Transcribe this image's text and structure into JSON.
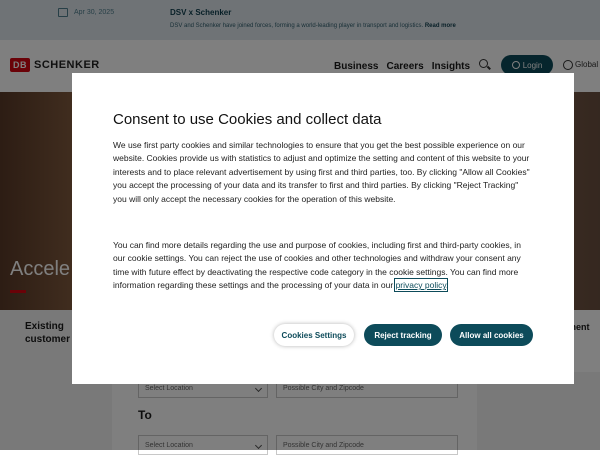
{
  "announcement": {
    "date": "Apr 30, 2025",
    "title": "DSV x Schenker",
    "text": "DSV and Schenker have joined forces, forming a world-leading player in transport and logistics.",
    "read_more": "Read more"
  },
  "header": {
    "logo_mark": "DB",
    "logo_name": "SCHENKER",
    "nav": [
      "Business",
      "Careers",
      "Insights"
    ],
    "login_label": "Login",
    "region_label": "Global"
  },
  "hero": {
    "headline": "Accele"
  },
  "page": {
    "existing_customer": "Existing customer",
    "right_panel": "ement",
    "to_label": "To",
    "select_location": "Select Location",
    "city_placeholder": "Possible City and Zipcode"
  },
  "cookie_modal": {
    "title": "Consent to use Cookies and collect data",
    "paragraph1": "We use first party cookies and similar technologies to ensure that you get the best possible experience on our website. Cookies provide us with statistics to adjust and optimize the setting and content of this website to your interests and to place relevant advertisement by using first and third parties, too. By clicking \"Allow all Cookies\" you accept the processing of your data and its transfer to first and third parties. By clicking \"Reject Tracking\" you will only accept the necessary cookies for the operation of this website.",
    "paragraph2": "You can find more details regarding the use and purpose of cookies, including first and third-party cookies, in our cookie settings. You can reject the use of cookies and other technologies and withdraw your consent any time with future effect by deactivating the respective code category in the cookie settings. You can find more information regarding these settings and the processing of your data in our",
    "privacy_link": "privacy policy",
    "privacy_suffix": ".",
    "buttons": {
      "settings": "Cookies Settings",
      "reject": "Reject tracking",
      "allow": "Allow all cookies"
    }
  },
  "colors": {
    "brand_red": "#d40511",
    "primary_teal": "#0d4b5a",
    "announcement_bg": "#dfe7ec"
  }
}
